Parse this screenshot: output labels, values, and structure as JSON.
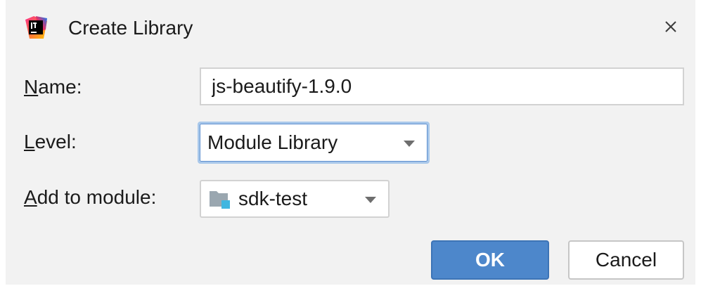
{
  "dialog": {
    "title": "Create Library",
    "app_icon": "intellij-idea-icon",
    "close_icon": "close-icon"
  },
  "form": {
    "name": {
      "label_mnemonic": "N",
      "label_rest": "ame:",
      "value": "js-beautify-1.9.0"
    },
    "level": {
      "label_mnemonic": "L",
      "label_rest": "evel:",
      "selected": "Module Library"
    },
    "module": {
      "label_mnemonic": "A",
      "label_rest": "dd to module:",
      "selected": "sdk-test",
      "icon": "module-folder-icon"
    }
  },
  "buttons": {
    "ok_label": "OK",
    "cancel_label": "Cancel"
  },
  "colors": {
    "dialog_bg": "#f2f2f2",
    "ok_bg": "#4d87cb",
    "focus_border": "#a9c8ea"
  }
}
